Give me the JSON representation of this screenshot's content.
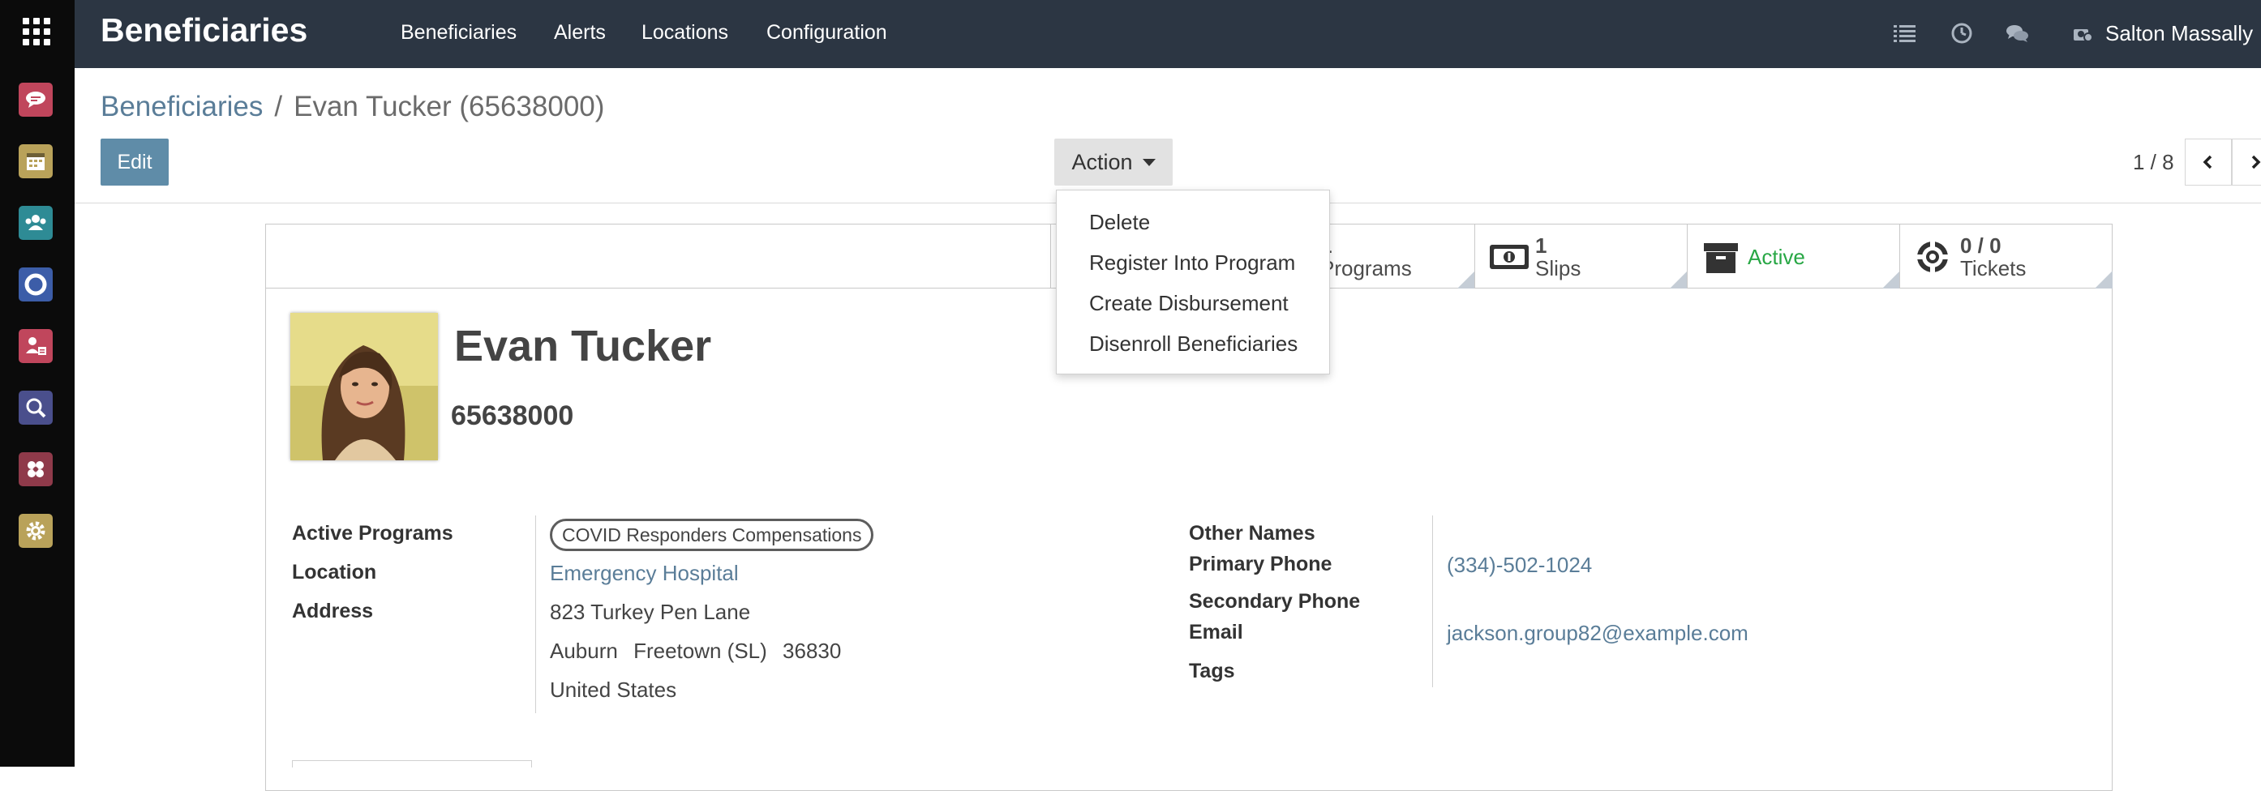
{
  "app": {
    "title": "Beneficiaries"
  },
  "topnav": {
    "menu": [
      "Beneficiaries",
      "Alerts",
      "Locations",
      "Configuration"
    ],
    "user": "Salton Massally"
  },
  "sidebar_apps": [
    "discuss-icon",
    "calendar-icon",
    "contacts-icon",
    "helpdesk-icon",
    "beneficiaries-icon",
    "search-icon",
    "programs-icon",
    "settings-icon"
  ],
  "breadcrumb": {
    "root": "Beneficiaries",
    "separator": "/",
    "current": "Evan Tucker (65638000)"
  },
  "toolbar": {
    "edit_label": "Edit",
    "action_label": "Action"
  },
  "pager": {
    "value": "1 / 8"
  },
  "action_menu": {
    "items": [
      "Delete",
      "Register Into Program",
      "Create Disbursement",
      "Disenroll Beneficiaries"
    ]
  },
  "stat_buttons": {
    "programs": {
      "count": "1",
      "label": "Programs"
    },
    "slips": {
      "count": "1",
      "label": "Slips"
    },
    "active": {
      "label": "Active"
    },
    "tickets": {
      "count": "0 / 0",
      "label": "Tickets"
    }
  },
  "record": {
    "name": "Evan Tucker",
    "id_number": "65638000"
  },
  "fields": {
    "active_programs": {
      "label": "Active Programs",
      "tags": [
        "COVID Responders Compensations"
      ]
    },
    "location": {
      "label": "Location",
      "value": "Emergency Hospital"
    },
    "address": {
      "label": "Address",
      "street": "823 Turkey Pen Lane",
      "city": "Auburn",
      "state": "Freetown (SL)",
      "zip": "36830",
      "country": "United States"
    },
    "other_names": {
      "label": "Other Names",
      "value": ""
    },
    "primary_phone": {
      "label": "Primary Phone",
      "value": "(334)-502-1024"
    },
    "secondary_phone": {
      "label": "Secondary Phone",
      "value": ""
    },
    "email": {
      "label": "Email",
      "value": "jackson.group82@example.com"
    },
    "tags": {
      "label": "Tags",
      "value": ""
    }
  },
  "colors": {
    "topbar": "#2c3643",
    "accent": "#5f8ca8",
    "link": "#5a7d98",
    "active": "#28a745"
  }
}
